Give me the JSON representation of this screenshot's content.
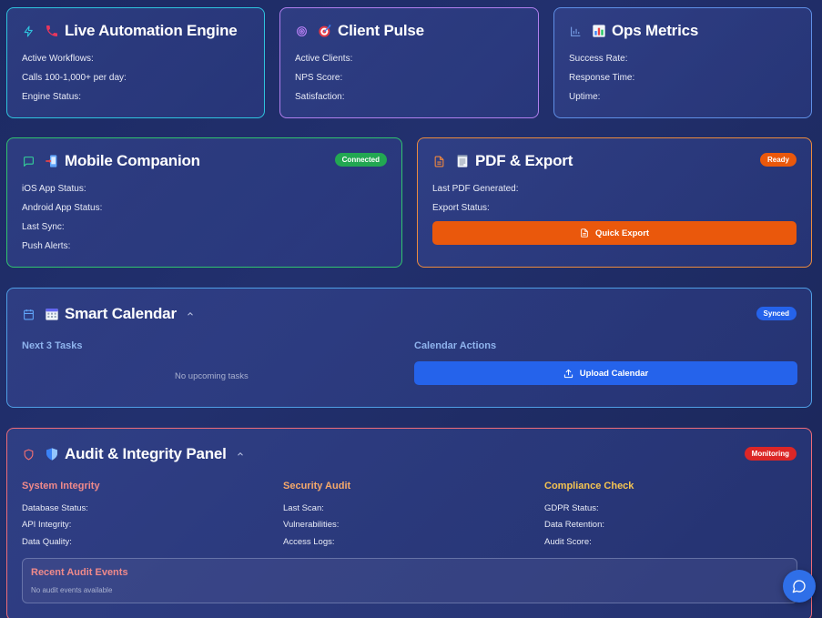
{
  "automation": {
    "title": "Live Automation Engine",
    "icon": "lightning-icon",
    "emoji": "📞",
    "rows": [
      "Active Workflows:",
      "Calls 100-1,000+ per day:",
      "Engine Status:"
    ]
  },
  "pulse": {
    "title": "Client Pulse",
    "icon": "target-ring-icon",
    "emoji": "🎯",
    "rows": [
      "Active Clients:",
      "NPS Score:",
      "Satisfaction:"
    ]
  },
  "ops": {
    "title": "Ops Metrics",
    "icon": "bar-chart-icon",
    "emoji": "📊",
    "rows": [
      "Success Rate:",
      "Response Time:",
      "Uptime:"
    ]
  },
  "mobile": {
    "title": "Mobile Companion",
    "icon": "message-square-icon",
    "emoji": "📲",
    "badge": "Connected",
    "rows": [
      "iOS App Status:",
      "Android App Status:",
      "Last Sync:",
      "Push Alerts:"
    ]
  },
  "pdf": {
    "title": "PDF & Export",
    "icon": "file-icon",
    "emoji": "🗒",
    "badge": "Ready",
    "rows": [
      "Last PDF Generated:",
      "Export Status:"
    ],
    "button": "Quick Export"
  },
  "calendar": {
    "title": "Smart Calendar",
    "icon": "calendar-icon",
    "emoji": "📅",
    "badge": "Synced",
    "tasks_label": "Next 3 Tasks",
    "empty_tasks": "No upcoming tasks",
    "actions_label": "Calendar Actions",
    "button": "Upload Calendar"
  },
  "audit": {
    "title": "Audit & Integrity Panel",
    "icon": "shield-icon",
    "emoji": "🛡️",
    "badge": "Monitoring",
    "columns": [
      {
        "heading": "System Integrity",
        "rows": [
          "Database Status:",
          "API Integrity:",
          "Data Quality:"
        ]
      },
      {
        "heading": "Security Audit",
        "rows": [
          "Last Scan:",
          "Vulnerabilities:",
          "Access Logs:"
        ]
      },
      {
        "heading": "Compliance Check",
        "rows": [
          "GDPR Status:",
          "Data Retention:",
          "Audit Score:"
        ]
      }
    ],
    "events_title": "Recent Audit Events",
    "events_empty": "No audit events available"
  },
  "colors": {
    "cyan": "#2fc4de",
    "violet": "#b07fee",
    "green": "#22a752",
    "orange": "#ea580c",
    "blue": "#2563eb",
    "red": "#dc2626",
    "section_red": "#f87171",
    "section_pink": "#f08a8a",
    "section_yellow": "#f5c451",
    "section_blue": "#8fb4ee"
  },
  "chat_button": {
    "icon": "chat-bubble-icon"
  }
}
